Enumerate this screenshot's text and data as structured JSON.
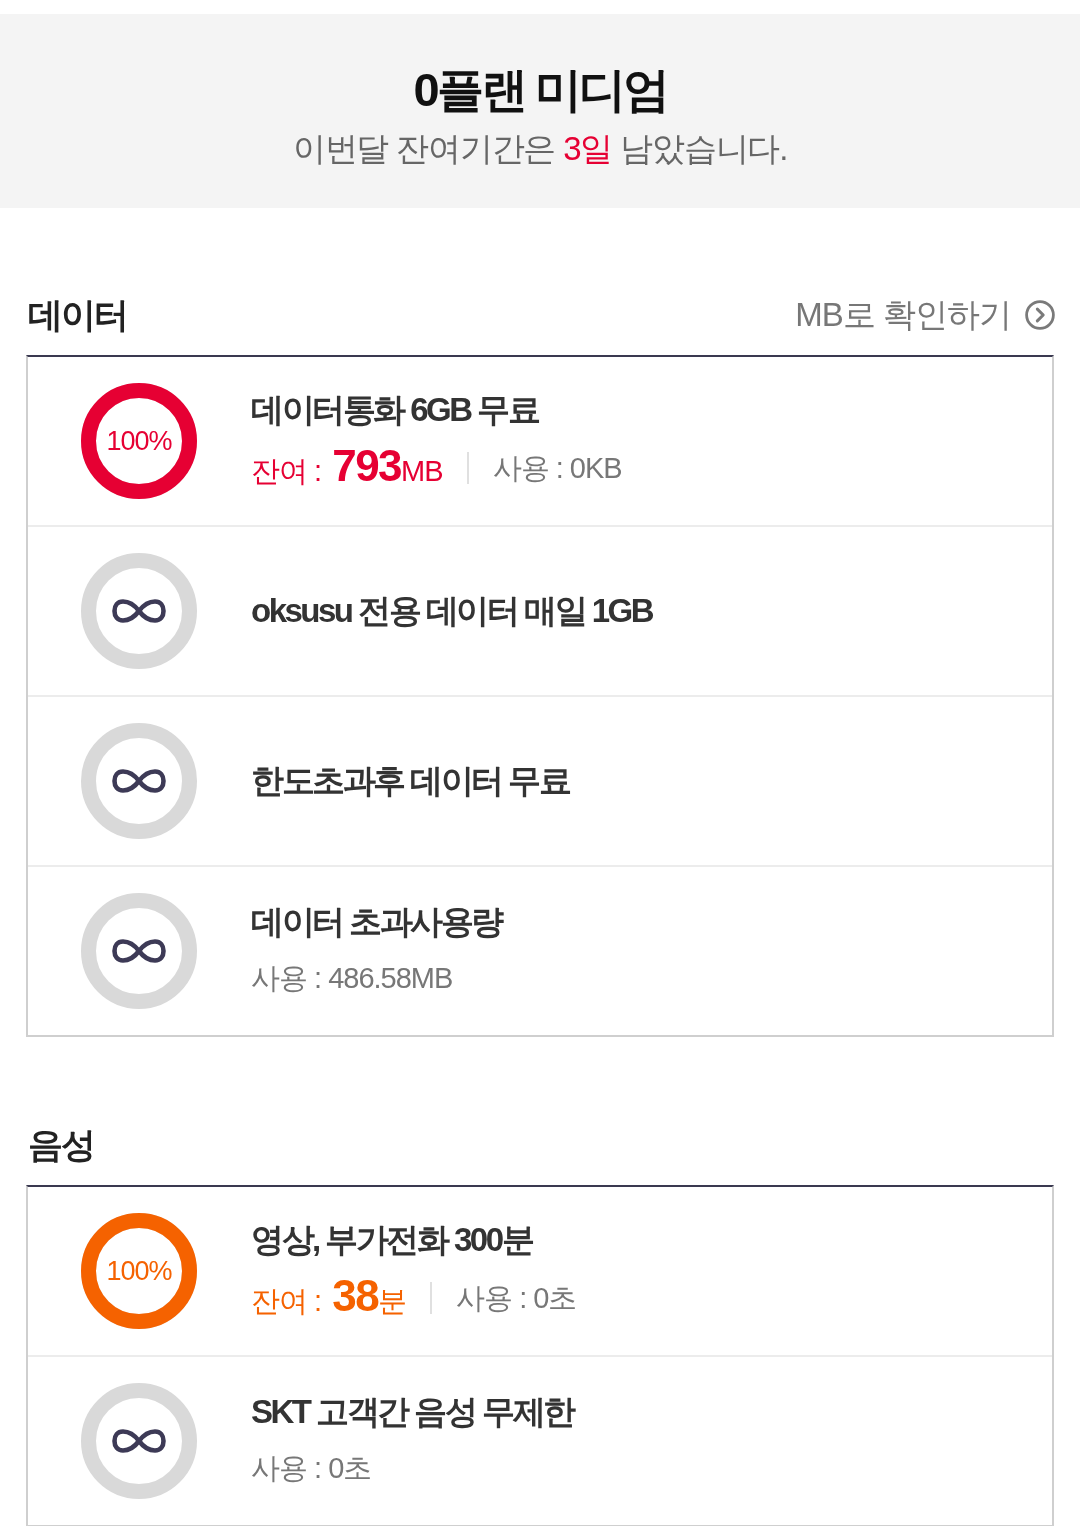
{
  "header": {
    "plan_name": "0플랜 미디엄",
    "notice": [
      {
        "text": "이번달 잔여기간은 ",
        "highlight": false
      },
      {
        "text": "3일",
        "highlight": true
      },
      {
        "text": " 남았습니다.",
        "highlight": false
      }
    ]
  },
  "sections": [
    {
      "title": "데이터",
      "link": {
        "label": "MB로 확인하기"
      },
      "items": [
        {
          "kind": "gauge",
          "color": "#e60033",
          "level": 1,
          "percent": "100%",
          "title": "데이터통화 6GB 무료",
          "remaining": "잔여 : **793**MB",
          "used": "사용 : 0KB"
        },
        {
          "kind": "unlimited",
          "title": "oksusu 전용 데이터 매일 1GB"
        },
        {
          "kind": "unlimited",
          "title": "한도초과후 데이터 무료"
        },
        {
          "kind": "unlimited",
          "title": "데이터 초과사용량",
          "used": "사용 : 486.58MB"
        }
      ]
    },
    {
      "title": "음성",
      "items": [
        {
          "kind": "gauge",
          "color": "#f56200",
          "level": 1,
          "percent": "100%",
          "title": "영상, 부가전화 300분",
          "remaining": "잔여 : **38**분",
          "used": "사용 : 0초"
        },
        {
          "kind": "unlimited",
          "title": "SKT 고객간 음성 무제한",
          "used": "사용 : 0초"
        }
      ]
    }
  ]
}
